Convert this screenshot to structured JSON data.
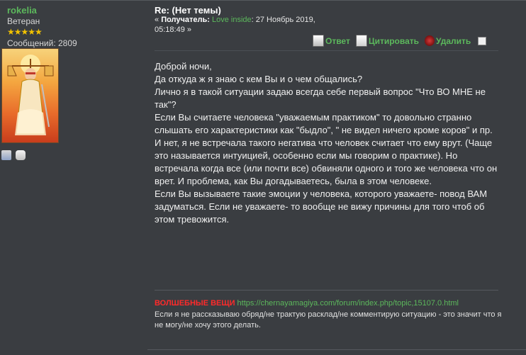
{
  "poster": {
    "name": "rokelia",
    "rank": "Ветеран",
    "stars": "★★★★★",
    "postcount": "Сообщений: 2809"
  },
  "post": {
    "title": "Re: (Нет темы)",
    "meta_prefix": "«",
    "recipient_label": "Получатель:",
    "recipient": "Love inside",
    "date": ": 27 Ноябрь 2019, 05:18:49 »",
    "body": [
      "Доброй ночи,",
      "Да откуда ж я знаю с кем Вы и о чем общались?",
      "Лично я в такой ситуации задаю всегда себе первый вопрос \"Что ВО МНЕ не так\"?",
      "Если Вы считаете человека \"уважаемым практиком\" то довольно странно слышать его характеристики как \"быдло\", \" не видел ничего кроме коров\" и пр.",
      "И нет, я не встречала такого негатива что человек считает что ему врут. (Чаще это называется интуицией, особенно если мы говорим о практике). Но встречала когда все (или почти все) обвиняли одного и того же человека что он врет. И проблема, как Вы догадываетесь, была в этом человеке.",
      "Если Вы вызываете такие эмоции у человека, которого уважаете- повод ВАМ задуматься. Если не уважаете- то вообще не вижу причины для того чтоб об этом тревожится."
    ]
  },
  "actions": {
    "reply": "Ответ",
    "quote": "Цитировать",
    "delete": "Удалить"
  },
  "signature": {
    "label": "ВОЛШЕБНЫЕ ВЕЩИ",
    "link": "https://chernayamagiya.com/forum/index.php/topic,15107.0.html",
    "text": "Если я не рассказываю обряд/не трактую расклад/не комментирую ситуацию - это значит что я не могу/не хочу этого делать."
  },
  "colors": {
    "accent_green": "#5cb85c",
    "signature_red": "#ff2a2a",
    "background": "#3a3d41"
  }
}
